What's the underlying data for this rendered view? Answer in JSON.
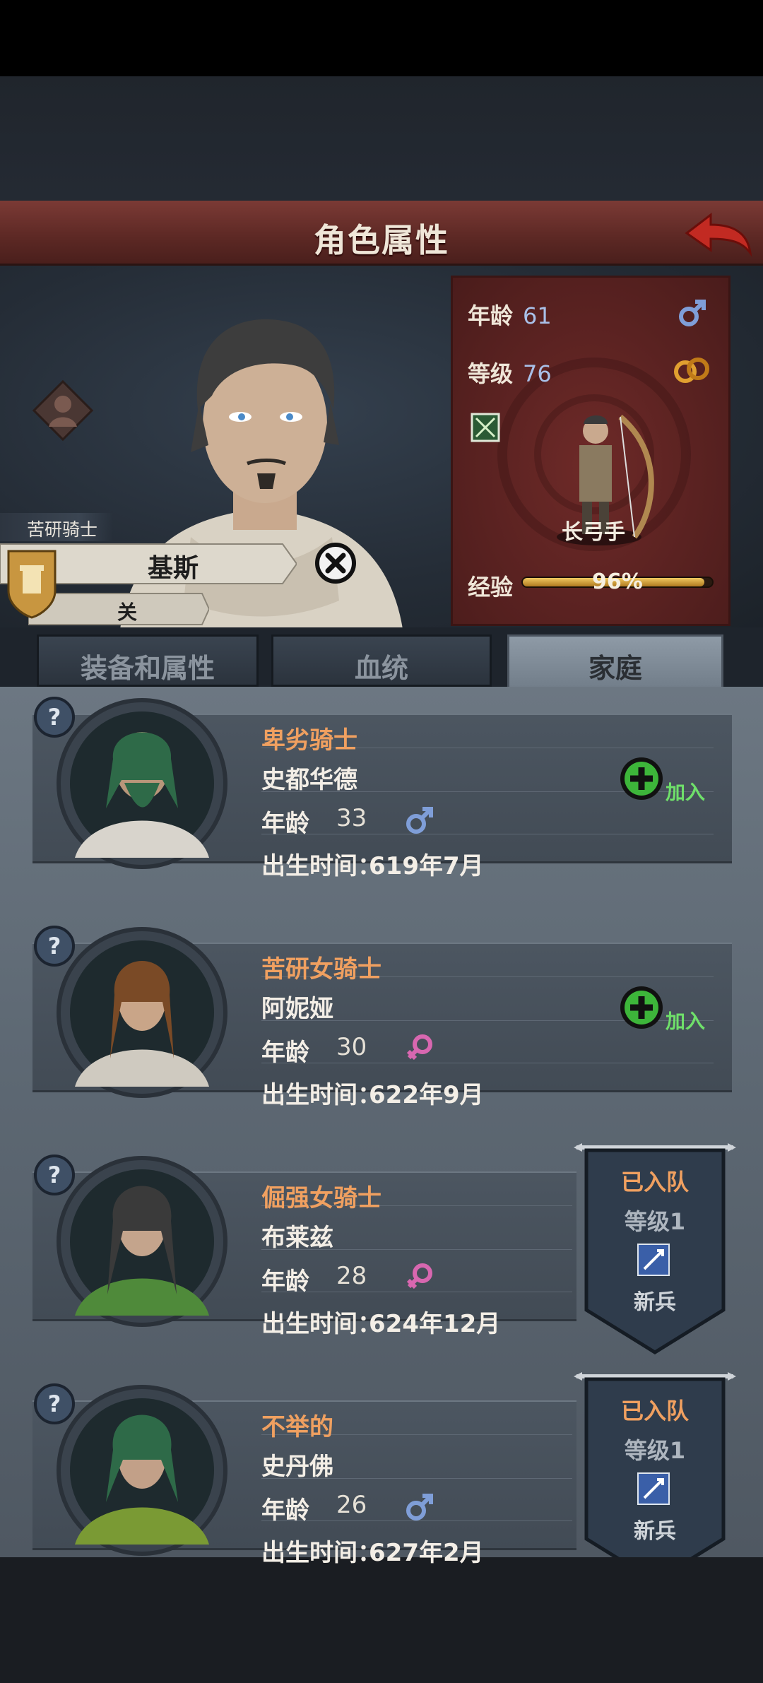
{
  "header": {
    "title": "角色属性"
  },
  "hero": {
    "title": "苦研骑士",
    "name": "基斯",
    "sub": "关",
    "stats": {
      "age_label": "年龄",
      "age_value": "61",
      "level_label": "等级",
      "level_value": "76",
      "class_name": "长弓手",
      "exp_label": "经验",
      "exp_value": "96%",
      "exp_fraction": 0.96
    }
  },
  "tabs": [
    {
      "label": "装备和属性"
    },
    {
      "label": "血统"
    },
    {
      "label": "家庭"
    }
  ],
  "members": [
    {
      "title": "卑劣骑士",
      "name": "史都华德",
      "age_label": "年龄",
      "age": "33",
      "sex": "male",
      "birth_label": "出生时间：",
      "birth": "619年7月",
      "join_label": "加入"
    },
    {
      "title": "苦研女骑士",
      "name": "阿妮娅",
      "age_label": "年龄",
      "age": "30",
      "sex": "female",
      "birth_label": "出生时间：",
      "birth": "622年9月",
      "join_label": "加入"
    },
    {
      "title": "倔强女骑士",
      "name": "布莱兹",
      "age_label": "年龄",
      "age": "28",
      "sex": "female",
      "birth_label": "出生时间：",
      "birth": "624年12月",
      "status": "已入队",
      "level": "等级1",
      "role": "新兵"
    },
    {
      "title": "不举的",
      "name": "史丹佛",
      "age_label": "年龄",
      "age": "26",
      "sex": "male",
      "birth_label": "出生时间：",
      "birth": "627年2月",
      "status": "已入队",
      "level": "等级1",
      "role": "新兵"
    }
  ],
  "colors": {
    "accent_orange": "#f0a060",
    "male": "#7f9ed8",
    "female": "#d867b0",
    "join_green": "#6fe06a"
  }
}
